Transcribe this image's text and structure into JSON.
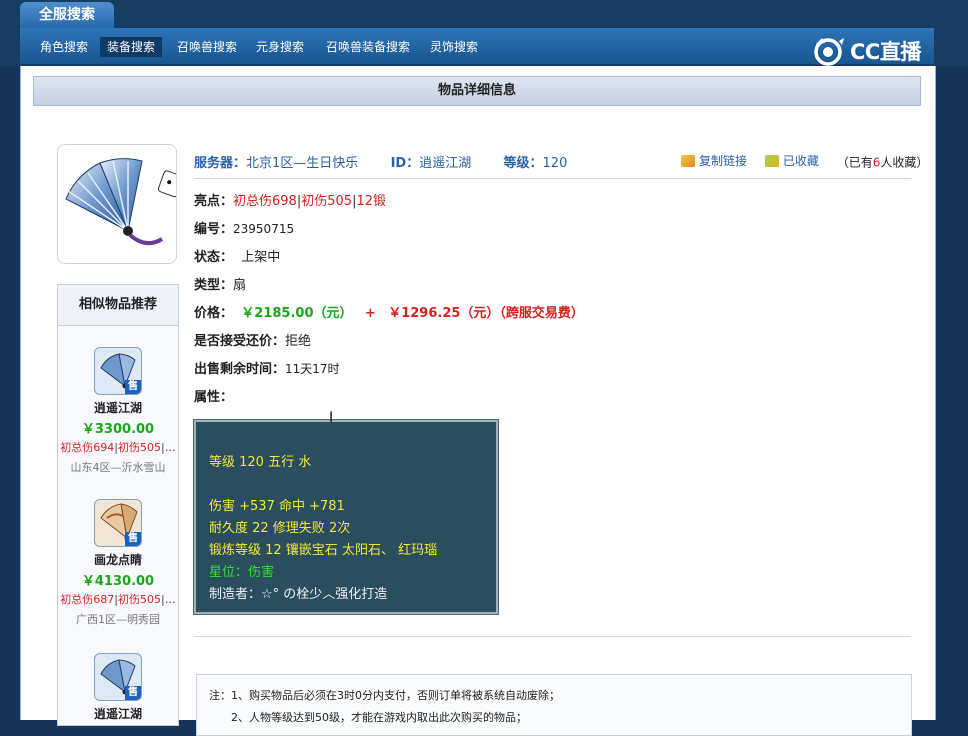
{
  "header": {
    "main_tab": "全服搜索",
    "nav": [
      "角色搜索",
      "装备搜索",
      "召唤兽搜索",
      "元身搜索",
      "召唤兽装备搜索",
      "灵饰搜索"
    ],
    "active_nav": "装备搜索",
    "logo": "CC直播"
  },
  "page": {
    "title": "物品详细信息"
  },
  "item": {
    "server_label": "服务器：",
    "server": "北京1区—生日快乐",
    "id_label": "ID：",
    "id": "逍遥江湖",
    "level_label": "等级：",
    "level": "120",
    "copy_link": "复制链接",
    "favorited": "已收藏",
    "fav_prefix": "（已有",
    "fav_count": "6",
    "fav_suffix": "人收藏）",
    "highlights_label": "亮点：",
    "highlights": [
      "初总伤698",
      "初伤505",
      "12锻"
    ],
    "number_label": "编号：",
    "number": "23950715",
    "status_label": "状态：",
    "status": "上架中",
    "type_label": "类型：",
    "type": "扇",
    "price_label": "价格：",
    "price": "￥2185.00（元）",
    "plus": "+",
    "fee": "￥1296.25（元）（跨服交易费）",
    "bargain_label": "是否接受还价：",
    "bargain": "拒绝",
    "remaining_label": "出售剩余时间：",
    "remaining": "11天17时",
    "attributes_label": "属性："
  },
  "attributes": {
    "line1": "等级 120  五行 水",
    "line2": "伤害 +537  命中 +781",
    "line3": "耐久度 22  修理失败 2次",
    "line4": "锻炼等级 12  镶嵌宝石 太阳石、 红玛瑙",
    "line5": "星位：伤害",
    "line6": "制造者：☆° の栓少︿强化打造"
  },
  "similar": {
    "title": "相似物品推荐",
    "items": [
      {
        "name": "逍遥江湖",
        "price": "￥3300.00",
        "tag1": "初总伤694",
        "tag2": "初伤505",
        "more": "…",
        "server": "山东4区—沂水雪山",
        "sale": "售"
      },
      {
        "name": "画龙点睛",
        "price": "￥4130.00",
        "tag1": "初总伤687",
        "tag2": "初伤505",
        "more": "…",
        "server": "广西1区—明秀园",
        "sale": "售"
      },
      {
        "name": "逍遥江湖",
        "sale": "售"
      }
    ]
  },
  "notes": {
    "line1": "注：1、购买物品后必须在3时0分内支付，否则订单将被系统自动废除；",
    "line2": "2、人物等级达到50级，才能在游戏内取出此次购买的物品；"
  },
  "colors": {
    "accent": "#2a62a8",
    "price_green": "#17a817",
    "highlight_red": "#d82020",
    "attr_bg": "#2b4e5e"
  }
}
